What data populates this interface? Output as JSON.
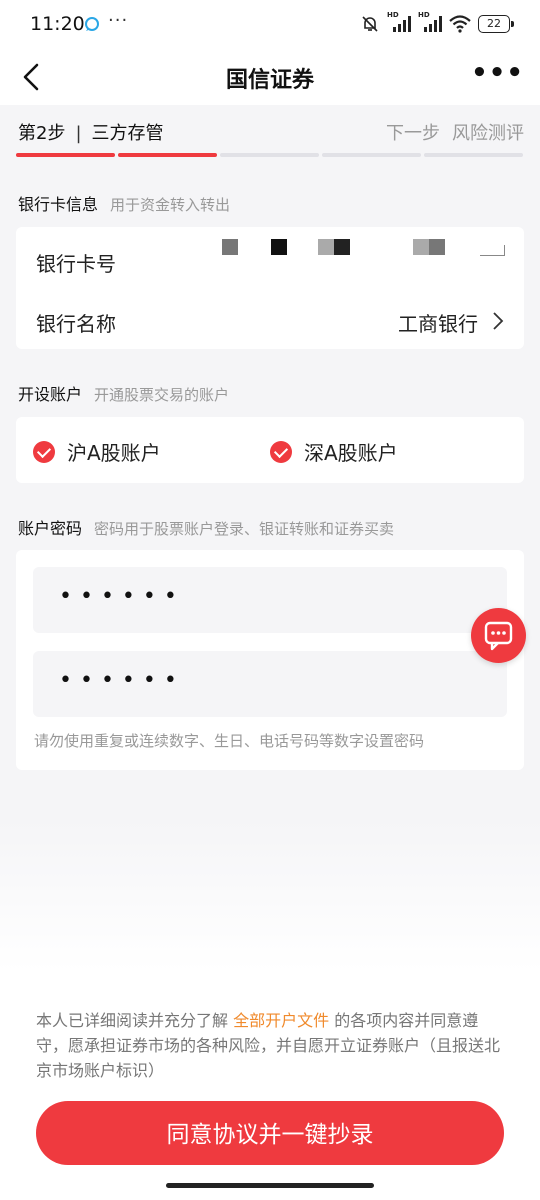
{
  "status": {
    "time": "11:20",
    "more": "···",
    "battery": "22",
    "signal_hd1": "HD",
    "signal_hd2": "HD"
  },
  "header": {
    "title": "国信证券",
    "more": "•••"
  },
  "steps": {
    "step": "第2步",
    "separator": "|",
    "current": "三方存管",
    "next": "下一步",
    "next_name": "风险测评",
    "total_segments": 5,
    "completed_segments": 2
  },
  "bank": {
    "section_title": "银行卡信息",
    "section_hint": "用于资金转入转出",
    "card_no_label": "银行卡号",
    "bank_name_label": "银行名称",
    "bank_name_value": "工商银行"
  },
  "account": {
    "section_title": "开设账户",
    "section_hint": "开通股票交易的账户",
    "sh_label": "沪A股账户",
    "sz_label": "深A股账户",
    "sh_checked": true,
    "sz_checked": true
  },
  "password": {
    "section_title": "账户密码",
    "section_hint": "密码用于股票账户登录、银证转账和证券买卖",
    "value1": "••••••",
    "value2": "••••••",
    "hint": "请勿使用重复或连续数字、生日、电话号码等数字设置密码"
  },
  "agreement": {
    "text_before": "本人已详细阅读并充分了解 ",
    "link": "全部开户文件",
    "text_after": " 的各项内容并同意遵守，愿承担证券市场的各种风险，并自愿开立证券账户（且报送北京市场账户标识）"
  },
  "cta": {
    "label": "同意协议并一键抄录"
  },
  "colors": {
    "accent": "#ef3a3f",
    "link": "#f08a2c"
  }
}
